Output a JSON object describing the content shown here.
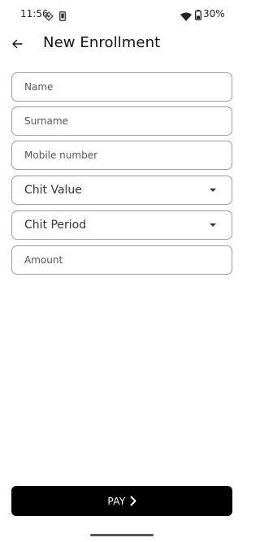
{
  "status_bar": {
    "time": "11:56",
    "battery_text": "30%",
    "icons": [
      "settings-sync-icon",
      "phone-icon",
      "wifi-icon",
      "battery-icon"
    ]
  },
  "header": {
    "title": "New Enrollment",
    "back_icon": "arrow-left-icon"
  },
  "form": {
    "name_placeholder": "Name",
    "surname_placeholder": "Surname",
    "mobile_placeholder": "Mobile number",
    "chit_value_label": "Chit Value",
    "chit_period_label": "Chit Period",
    "amount_placeholder": "Amount"
  },
  "pay_button": {
    "label": "PAY",
    "icon": "chevron-right-icon"
  },
  "colors": {
    "button_bg": "#000000",
    "field_border": "#9e9e9e",
    "background": "#ffffff"
  }
}
